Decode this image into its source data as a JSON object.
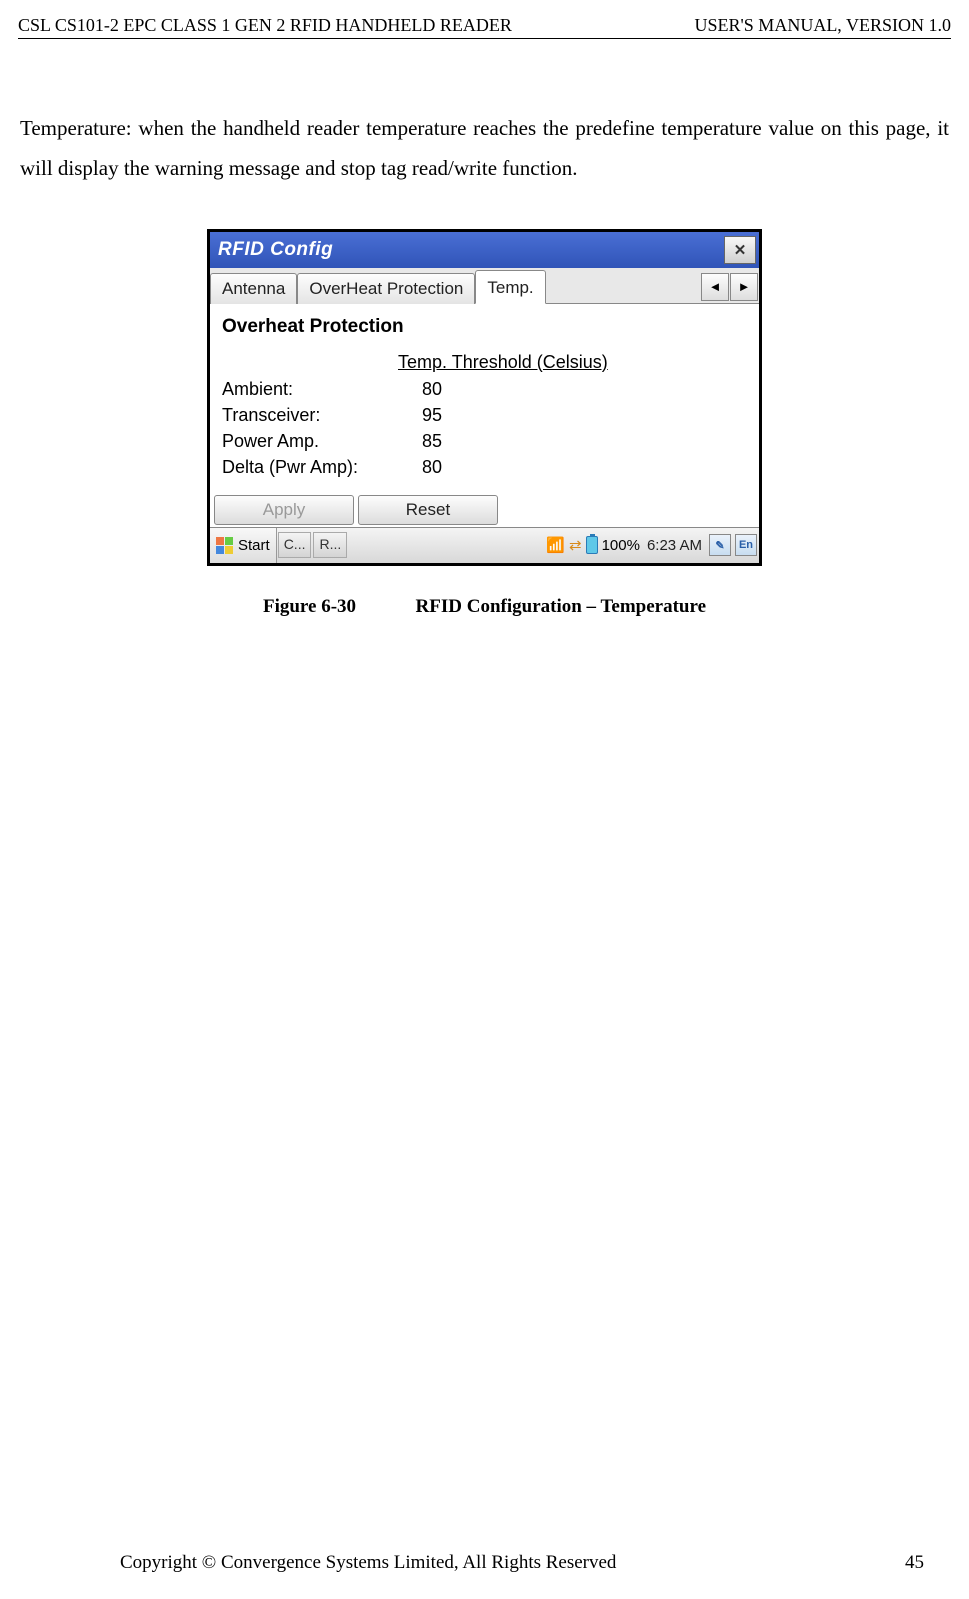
{
  "header": {
    "left": "CSL CS101-2 EPC CLASS 1 GEN 2 RFID HANDHELD READER",
    "right": "USER'S  MANUAL,  VERSION  1.0"
  },
  "description": "Temperature: when the handheld reader temperature reaches the predefine temperature value on this page, it will display the warning message and stop tag read/write function.",
  "window": {
    "title": "RFID Config",
    "tabs": {
      "t1": "Antenna",
      "t2": "OverHeat Protection",
      "t3": "Temp."
    },
    "heading": "Overheat Protection",
    "columnHeader": "Temp. Threshold (Celsius)",
    "rows": {
      "r1": {
        "label": "Ambient:",
        "value": "80"
      },
      "r2": {
        "label": "Transceiver:",
        "value": "95"
      },
      "r3": {
        "label": "Power Amp.",
        "value": "85"
      },
      "r4": {
        "label": "Delta (Pwr Amp):",
        "value": "80"
      }
    },
    "buttons": {
      "apply": "Apply",
      "reset": "Reset"
    },
    "taskbar": {
      "start": "Start",
      "app1": "C...",
      "app2": "R...",
      "battery": "100%",
      "time": "6:23 AM",
      "ime": "En"
    }
  },
  "caption": {
    "fig": "Figure 6-30",
    "text": "RFID Configuration – Temperature"
  },
  "footer": {
    "copyright": "Copyright © Convergence Systems Limited, All Rights Reserved",
    "page": "45"
  }
}
